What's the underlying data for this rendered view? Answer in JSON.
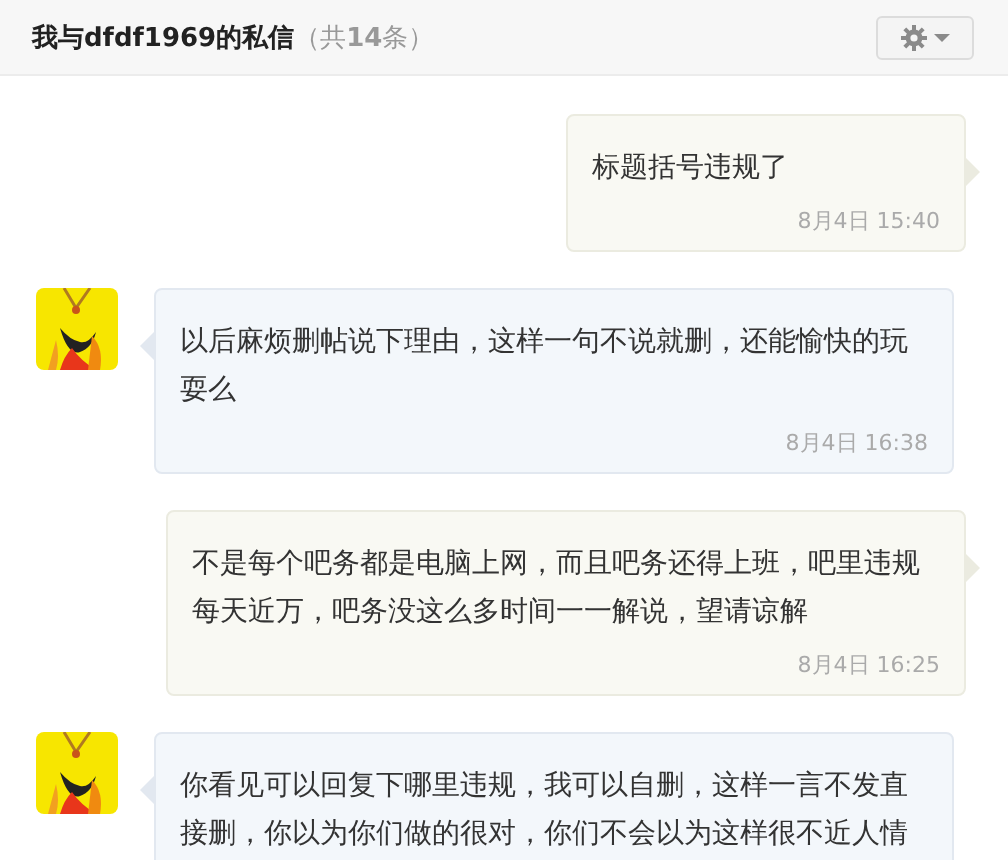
{
  "header": {
    "title": "我与dfdf1969的私信",
    "count": "（共**14**条）"
  },
  "messages": [
    {
      "kind": "sent",
      "text": "标题括号违规了",
      "time": "8月4日 15:40"
    },
    {
      "kind": "received",
      "text": "以后麻烦删帖说下理由，这样一句不说就删，还能愉快的玩耍么",
      "time": "8月4日 16:38"
    },
    {
      "kind": "sent",
      "text": "不是每个吧务都是电脑上网，而且吧务还得上班，吧里违规每天近万，吧务没这么多时间一一解说，望请谅解",
      "time": "8月4日 16:25"
    },
    {
      "kind": "received",
      "text": "你看见可以回复下哪里违规，我可以自删，这样一言不发直接删，你以为你们做的很对，你们不会以为这样很不近人情"
    }
  ]
}
